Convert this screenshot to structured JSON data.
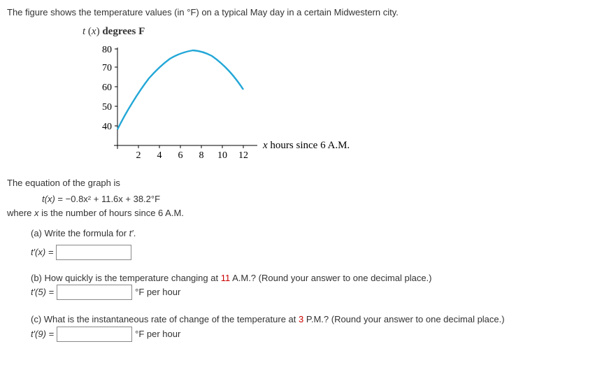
{
  "intro": "The figure shows the temperature values (in °F) on a typical May day in a certain Midwestern city.",
  "chart_data": {
    "type": "line",
    "title": "",
    "ylabel_var": "t",
    "ylabel_arg": "x",
    "ylabel_text": "degrees F",
    "xlabel_var": "x",
    "xlabel_text": "hours since 6 A.M.",
    "x_ticks": [
      2,
      4,
      6,
      8,
      10,
      12
    ],
    "y_ticks": [
      40,
      50,
      60,
      70,
      80
    ],
    "xlim": [
      0,
      13
    ],
    "ylim": [
      35,
      85
    ],
    "series": [
      {
        "name": "t(x)",
        "color": "#23a7d7",
        "x": [
          0,
          1,
          2,
          3,
          4,
          5,
          6,
          7,
          8,
          9,
          10,
          11,
          12
        ],
        "y": [
          38.2,
          49.0,
          58.2,
          65.8,
          71.8,
          76.2,
          79.0,
          80.2,
          79.8,
          77.8,
          74.2,
          69.0,
          62.2
        ]
      }
    ]
  },
  "eq_intro": "The equation of the graph is",
  "equation_lhs_func": "t",
  "equation_lhs_arg": "x",
  "equation_rhs": "−0.8x² + 11.6x + 38.2°F",
  "where_text_pre": "where ",
  "where_var": "x",
  "where_text_post": " is the number of hours since 6 A.M.",
  "parts": {
    "a": {
      "prompt_pre": "(a) Write the formula for  ",
      "prompt_sym": "t′",
      "prompt_post": ".",
      "lhs": "t′(x) = ",
      "value": ""
    },
    "b": {
      "prompt_pre": "(b) How quickly is the temperature changing at ",
      "prompt_red": "11",
      "prompt_post": " A.M.? (Round your answer to one decimal place.)",
      "lhs": "t′(5) = ",
      "value": "",
      "unit": "°F per hour"
    },
    "c": {
      "prompt_pre": "(c) What is the instantaneous rate of change of the temperature at ",
      "prompt_red": "3",
      "prompt_post": " P.M.? (Round your answer to one decimal place.)",
      "lhs": "t′(9) = ",
      "value": "",
      "unit": "°F per hour"
    }
  }
}
